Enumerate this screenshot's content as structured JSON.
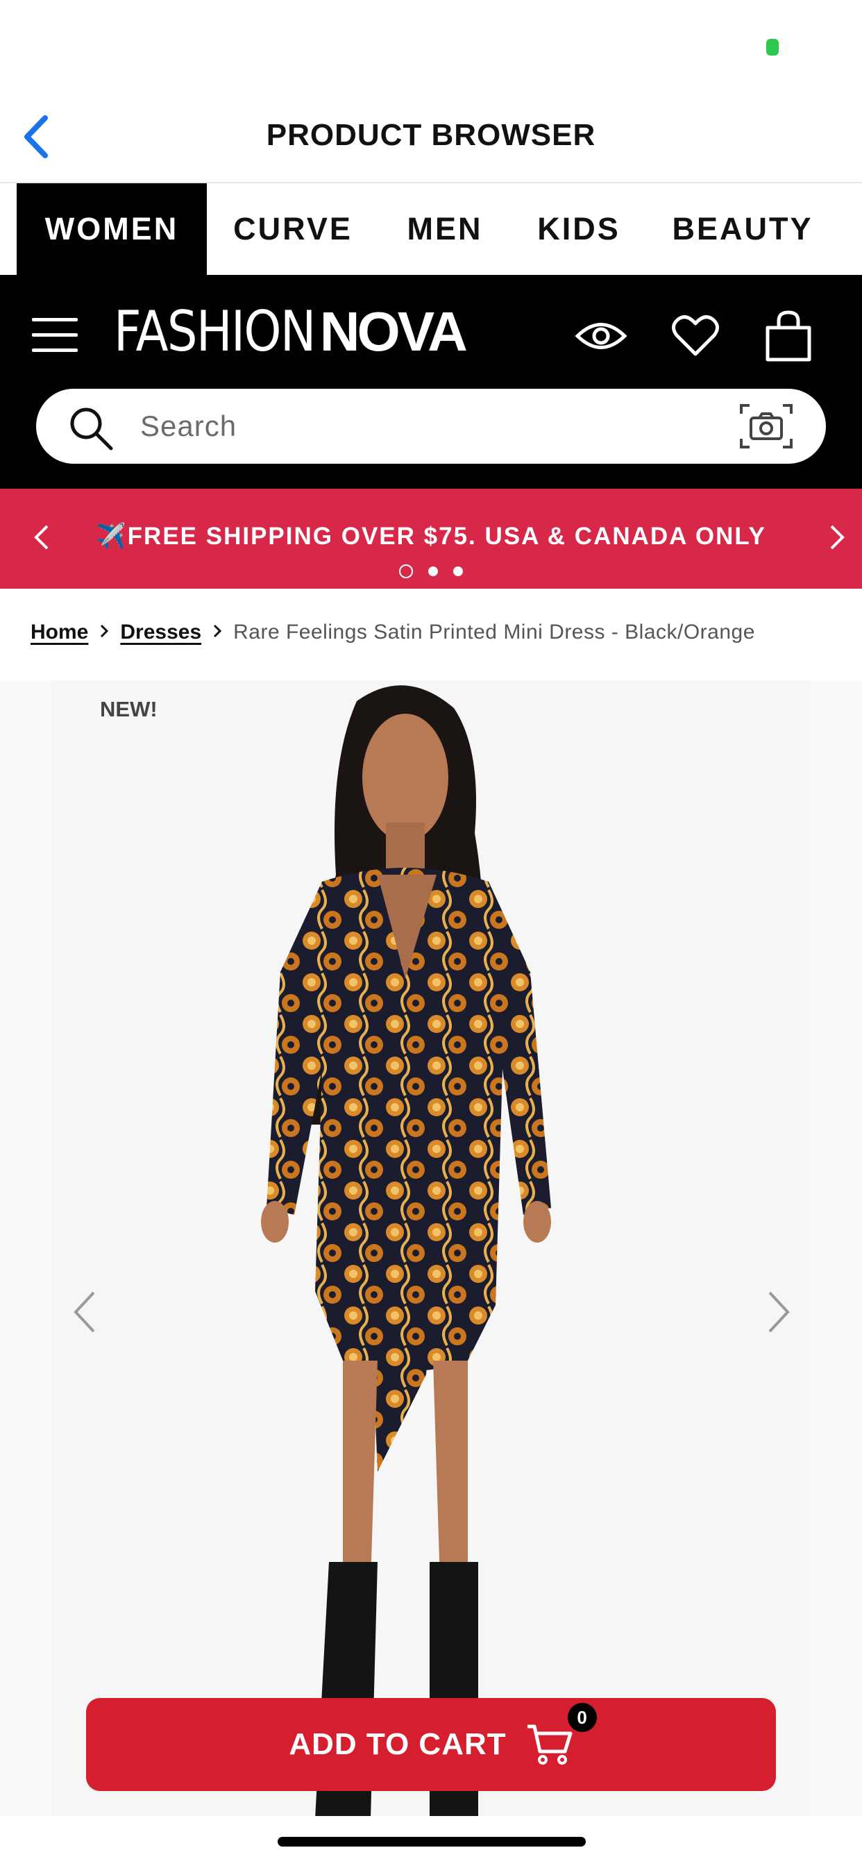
{
  "nav": {
    "title": "PRODUCT BROWSER"
  },
  "categories": [
    {
      "label": "WOMEN",
      "active": true
    },
    {
      "label": "CURVE",
      "active": false
    },
    {
      "label": "MEN",
      "active": false
    },
    {
      "label": "KIDS",
      "active": false
    },
    {
      "label": "BEAUTY",
      "active": false
    }
  ],
  "brand": {
    "logo_thin": "FASHION",
    "logo_bold": "NOVA"
  },
  "header_icons": [
    "menu-icon",
    "eye-icon",
    "heart-icon",
    "shopping-bag-icon"
  ],
  "search": {
    "placeholder": "Search",
    "value": ""
  },
  "promo": {
    "text": "✈️FREE SHIPPING OVER $75. USA & CANADA ONLY",
    "slides": 3,
    "active_slide": 1
  },
  "breadcrumb": {
    "home": "Home",
    "category": "Dresses",
    "current": "Rare Feelings Satin Printed Mini Dress - Black/Orange"
  },
  "product": {
    "badge": "NEW!",
    "image_description_icon": "product-photo"
  },
  "cart": {
    "label": "ADD TO CART",
    "count": "0"
  },
  "colors": {
    "accent_red": "#d51f2e",
    "promo_red": "#d7284a",
    "ios_blue": "#1a73e8",
    "brand_black": "#000000"
  }
}
